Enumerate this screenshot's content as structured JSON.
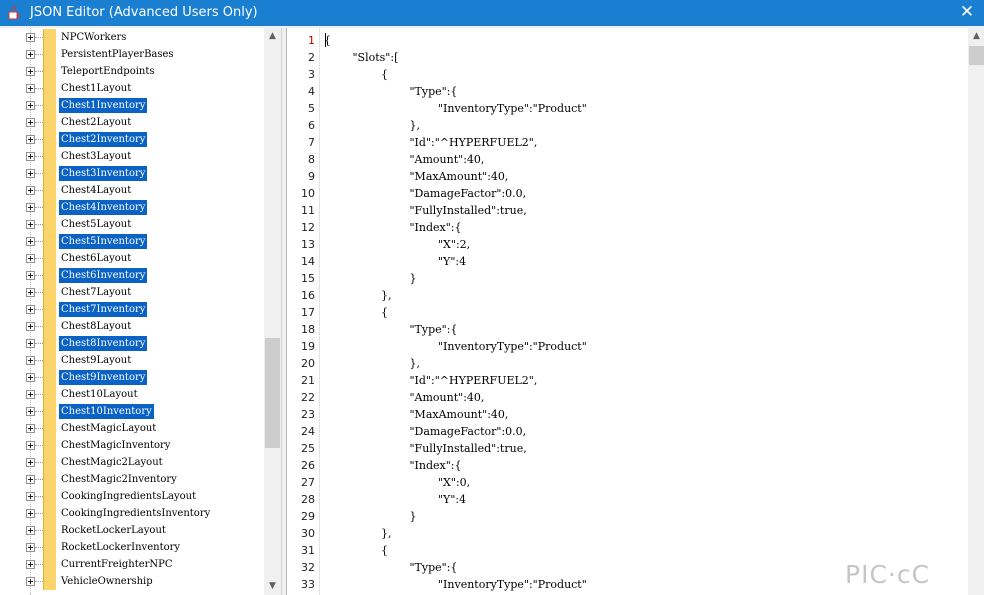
{
  "window": {
    "title": "JSON Editor (Advanced Users Only)",
    "close_glyph": "✕",
    "app_icon": "java-cup-icon",
    "accent": "#1a7fd0"
  },
  "tree": {
    "selection_color": "#0a62c4",
    "items": [
      {
        "label": "NPCWorkers",
        "selected": false
      },
      {
        "label": "PersistentPlayerBases",
        "selected": false
      },
      {
        "label": "TeleportEndpoints",
        "selected": false
      },
      {
        "label": "Chest1Layout",
        "selected": false
      },
      {
        "label": "Chest1Inventory",
        "selected": true
      },
      {
        "label": "Chest2Layout",
        "selected": false
      },
      {
        "label": "Chest2Inventory",
        "selected": true
      },
      {
        "label": "Chest3Layout",
        "selected": false
      },
      {
        "label": "Chest3Inventory",
        "selected": true
      },
      {
        "label": "Chest4Layout",
        "selected": false
      },
      {
        "label": "Chest4Inventory",
        "selected": true
      },
      {
        "label": "Chest5Layout",
        "selected": false
      },
      {
        "label": "Chest5Inventory",
        "selected": true
      },
      {
        "label": "Chest6Layout",
        "selected": false
      },
      {
        "label": "Chest6Inventory",
        "selected": true
      },
      {
        "label": "Chest7Layout",
        "selected": false
      },
      {
        "label": "Chest7Inventory",
        "selected": true
      },
      {
        "label": "Chest8Layout",
        "selected": false
      },
      {
        "label": "Chest8Inventory",
        "selected": true
      },
      {
        "label": "Chest9Layout",
        "selected": false
      },
      {
        "label": "Chest9Inventory",
        "selected": true
      },
      {
        "label": "Chest10Layout",
        "selected": false
      },
      {
        "label": "Chest10Inventory",
        "selected": true
      },
      {
        "label": "ChestMagicLayout",
        "selected": false
      },
      {
        "label": "ChestMagicInventory",
        "selected": false
      },
      {
        "label": "ChestMagic2Layout",
        "selected": false
      },
      {
        "label": "ChestMagic2Inventory",
        "selected": false
      },
      {
        "label": "CookingIngredientsLayout",
        "selected": false
      },
      {
        "label": "CookingIngredientsInventory",
        "selected": false
      },
      {
        "label": "RocketLockerLayout",
        "selected": false
      },
      {
        "label": "RocketLockerInventory",
        "selected": false
      },
      {
        "label": "CurrentFreighterNPC",
        "selected": false
      },
      {
        "label": "VehicleOwnership",
        "selected": false
      }
    ],
    "scroll_up_glyph": "▲",
    "scroll_down_glyph": "▼"
  },
  "editor": {
    "first_line_number_color": "#c00000",
    "scroll_up_glyph": "▲",
    "lines": [
      {
        "n": "1",
        "indent": 0,
        "text": "{"
      },
      {
        "n": "2",
        "indent": 1,
        "text": "\"Slots\":["
      },
      {
        "n": "3",
        "indent": 2,
        "text": "{"
      },
      {
        "n": "4",
        "indent": 3,
        "text": "\"Type\":{"
      },
      {
        "n": "5",
        "indent": 4,
        "text": "\"InventoryType\":\"Product\""
      },
      {
        "n": "6",
        "indent": 3,
        "text": "},"
      },
      {
        "n": "7",
        "indent": 3,
        "text": "\"Id\":\"^HYPERFUEL2\","
      },
      {
        "n": "8",
        "indent": 3,
        "text": "\"Amount\":40,"
      },
      {
        "n": "9",
        "indent": 3,
        "text": "\"MaxAmount\":40,"
      },
      {
        "n": "10",
        "indent": 3,
        "text": "\"DamageFactor\":0.0,"
      },
      {
        "n": "11",
        "indent": 3,
        "text": "\"FullyInstalled\":true,"
      },
      {
        "n": "12",
        "indent": 3,
        "text": "\"Index\":{"
      },
      {
        "n": "13",
        "indent": 4,
        "text": "\"X\":2,"
      },
      {
        "n": "14",
        "indent": 4,
        "text": "\"Y\":4"
      },
      {
        "n": "15",
        "indent": 3,
        "text": "}"
      },
      {
        "n": "16",
        "indent": 2,
        "text": "},"
      },
      {
        "n": "17",
        "indent": 2,
        "text": "{"
      },
      {
        "n": "18",
        "indent": 3,
        "text": "\"Type\":{"
      },
      {
        "n": "19",
        "indent": 4,
        "text": "\"InventoryType\":\"Product\""
      },
      {
        "n": "20",
        "indent": 3,
        "text": "},"
      },
      {
        "n": "21",
        "indent": 3,
        "text": "\"Id\":\"^HYPERFUEL2\","
      },
      {
        "n": "22",
        "indent": 3,
        "text": "\"Amount\":40,"
      },
      {
        "n": "23",
        "indent": 3,
        "text": "\"MaxAmount\":40,"
      },
      {
        "n": "24",
        "indent": 3,
        "text": "\"DamageFactor\":0.0,"
      },
      {
        "n": "25",
        "indent": 3,
        "text": "\"FullyInstalled\":true,"
      },
      {
        "n": "26",
        "indent": 3,
        "text": "\"Index\":{"
      },
      {
        "n": "27",
        "indent": 4,
        "text": "\"X\":0,"
      },
      {
        "n": "28",
        "indent": 4,
        "text": "\"Y\":4"
      },
      {
        "n": "29",
        "indent": 3,
        "text": "}"
      },
      {
        "n": "30",
        "indent": 2,
        "text": "},"
      },
      {
        "n": "31",
        "indent": 2,
        "text": "{"
      },
      {
        "n": "32",
        "indent": 3,
        "text": "\"Type\":{"
      },
      {
        "n": "33",
        "indent": 4,
        "text": "\"InventoryType\":\"Product\""
      }
    ]
  },
  "watermark": "PIC·cC"
}
